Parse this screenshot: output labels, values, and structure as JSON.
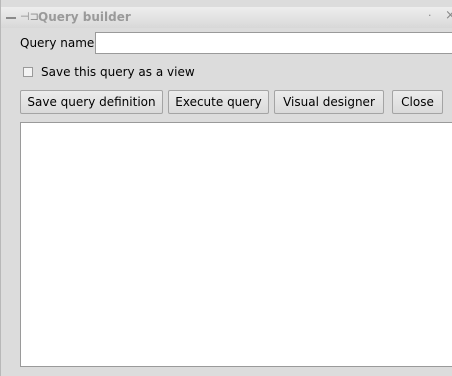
{
  "window": {
    "title": "Query builder",
    "pin_icon": "pin-icon",
    "close_glyph": "×",
    "dot_glyph": "·",
    "pin_glyph": "⊣⊐"
  },
  "form": {
    "query_name_label": "Query name",
    "query_name_value": "",
    "save_as_view_label": "Save this query as a view",
    "save_as_view_checked": false
  },
  "buttons": {
    "save_definition": "Save query definition",
    "execute": "Execute query",
    "visual_designer": "Visual designer",
    "close": "Close"
  },
  "results": {
    "content": ""
  }
}
